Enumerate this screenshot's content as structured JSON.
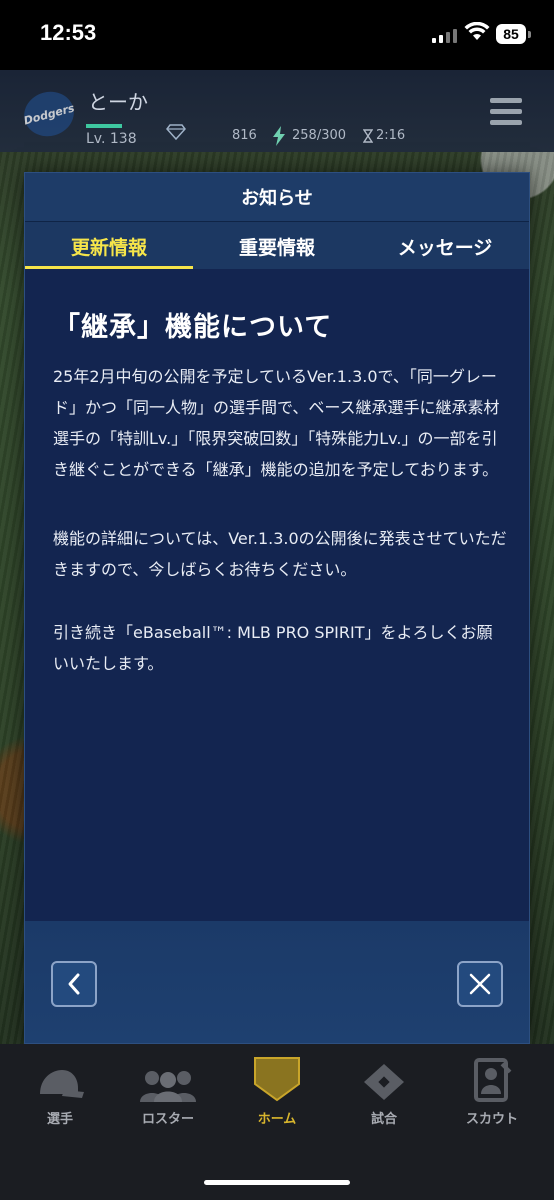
{
  "status_bar": {
    "time": "12:53",
    "battery": "85"
  },
  "player": {
    "name": "とーか",
    "team_logo_text": "Dodgers",
    "level": "Lv. 138",
    "gems": "816",
    "stamina": "258/300",
    "timer": "2:16"
  },
  "modal": {
    "title": "お知らせ",
    "tabs": [
      {
        "label": "更新情報",
        "active": true
      },
      {
        "label": "重要情報",
        "active": false
      },
      {
        "label": "メッセージ",
        "active": false
      }
    ],
    "article": {
      "title": "「継承」機能について",
      "paragraphs": [
        "25年2月中旬の公開を予定しているVer.1.3.0で、「同一グレード」かつ「同一人物」の選手間で、ベース継承選手に継承素材選手の「特訓Lv.」「限界突破回数」「特殊能力Lv.」の一部を引き継ぐことができる「継承」機能の追加を予定しております。",
        "機能の詳細については、Ver.1.3.0の公開後に発表させていただきますので、今しばらくお待ちください。",
        "引き続き「eBaseball™: MLB PRO SPIRIT」をよろしくお願いいたします。"
      ]
    }
  },
  "bottom_nav": [
    {
      "label": "選手",
      "active": false
    },
    {
      "label": "ロスター",
      "active": false
    },
    {
      "label": "ホーム",
      "active": true
    },
    {
      "label": "試合",
      "active": false
    },
    {
      "label": "スカウト",
      "active": false
    }
  ],
  "colors": {
    "accent": "#f6e54a",
    "panel": "#132550",
    "header": "#1e3c68",
    "home_active": "#d9b62d"
  }
}
